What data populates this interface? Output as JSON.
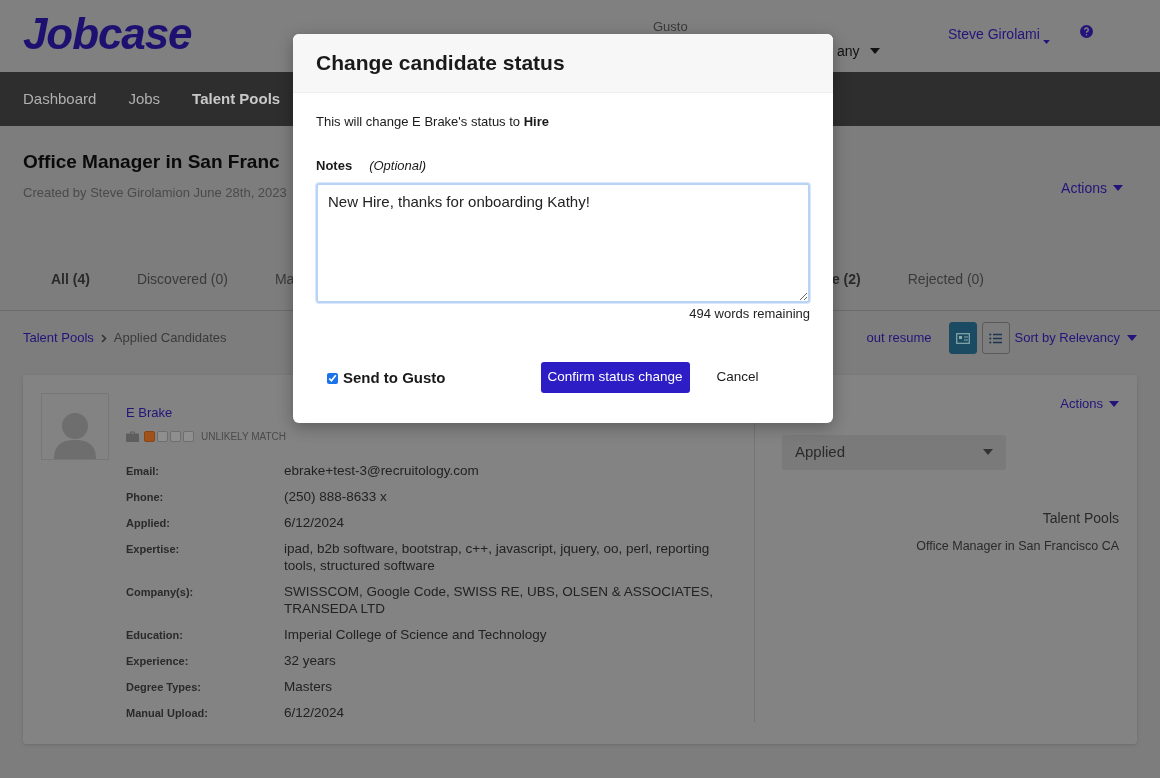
{
  "header": {
    "logo": "Jobcase",
    "company_label": "Gusto",
    "company_value": "any",
    "user": "Steve Girolami"
  },
  "nav": [
    {
      "label": "Dashboard",
      "selected": false
    },
    {
      "label": "Jobs",
      "selected": false
    },
    {
      "label": "Talent Pools",
      "selected": true
    }
  ],
  "job": {
    "title": "Office Manager in San Franc",
    "created": "Created by Steve Girolamion June 28th, 2023",
    "actions": "Actions"
  },
  "tabs_left": [
    {
      "label": "All (4)",
      "selected": true
    },
    {
      "label": "Discovered (0)",
      "selected": false
    },
    {
      "label": "Ma",
      "selected": false
    }
  ],
  "tabs_right": [
    {
      "label": "e (2)",
      "selected": true
    },
    {
      "label": "Rejected (0)",
      "selected": false
    }
  ],
  "breadcrumb": {
    "link": "Talent Pools",
    "current": "Applied Candidates"
  },
  "toolbar": {
    "resume_link": "out resume",
    "views": [
      {
        "kind": "card",
        "selected": true
      },
      {
        "kind": "list",
        "selected": false
      }
    ],
    "sort": "Sort by Relevancy"
  },
  "candidate": {
    "name": "E Brake",
    "stars": 1,
    "match": "UNLIKELY MATCH",
    "actions": "Actions",
    "status": "Applied",
    "pools_heading": "Talent Pools",
    "pools_value": "Office Manager in San Francisco CA",
    "fields": [
      {
        "label": "Email:",
        "value": "ebrake+test-3@recruitology.com"
      },
      {
        "label": "Phone:",
        "value": "(250) 888-8633 x"
      },
      {
        "label": "Applied:",
        "value": "6/12/2024"
      },
      {
        "label": "Expertise:",
        "value": "ipad, b2b software, bootstrap, c++, javascript, jquery, oo, perl, reporting tools, structured software"
      },
      {
        "label": "Company(s):",
        "value": "SWISSCOM, Google Code, SWISS RE, UBS, OLSEN & ASSOCIATES, TRANSEDA LTD"
      },
      {
        "label": "Education:",
        "value": "Imperial College of Science and Technology"
      },
      {
        "label": "Experience:",
        "value": "32 years"
      },
      {
        "label": "Degree Types:",
        "value": "Masters"
      },
      {
        "label": "Manual Upload:",
        "value": "6/12/2024"
      }
    ]
  },
  "modal": {
    "title": "Change candidate status",
    "message": "This will change E Brake's status to **Hire**",
    "notes_label": "Notes",
    "notes_hint": "(Optional)",
    "notes_value": "New Hire, thanks for onboarding Kathy!",
    "remaining": "494 words remaining",
    "send_label": "Send to Gusto",
    "send_checked": true,
    "confirm": "Confirm status change",
    "cancel": "Cancel"
  }
}
